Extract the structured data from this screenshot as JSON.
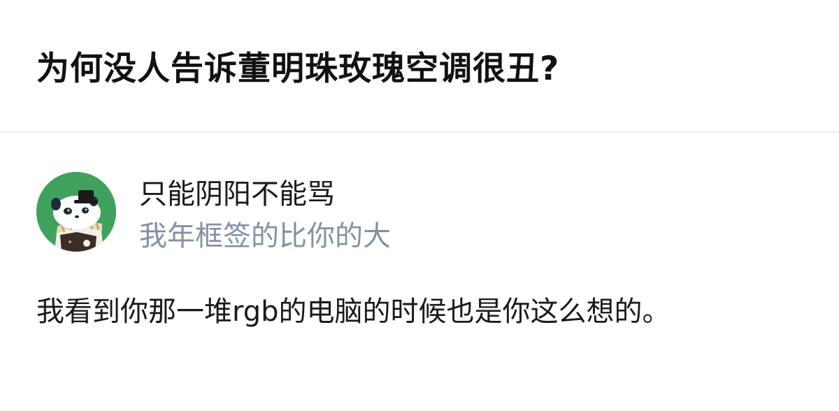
{
  "question": {
    "title": "为何没人告诉董明珠玫瑰空调很丑?"
  },
  "answer": {
    "author": {
      "name": "只能阴阳不能骂",
      "bio": "我年框签的比你的大",
      "avatar_icon": "panda-avatar-icon"
    },
    "content": "我看到你那一堆rgb的电脑的时候也是你这么想的。"
  },
  "colors": {
    "avatar_bg": "#3fa15d",
    "bio_text": "#8590a6",
    "divider": "#f0f0f2"
  }
}
